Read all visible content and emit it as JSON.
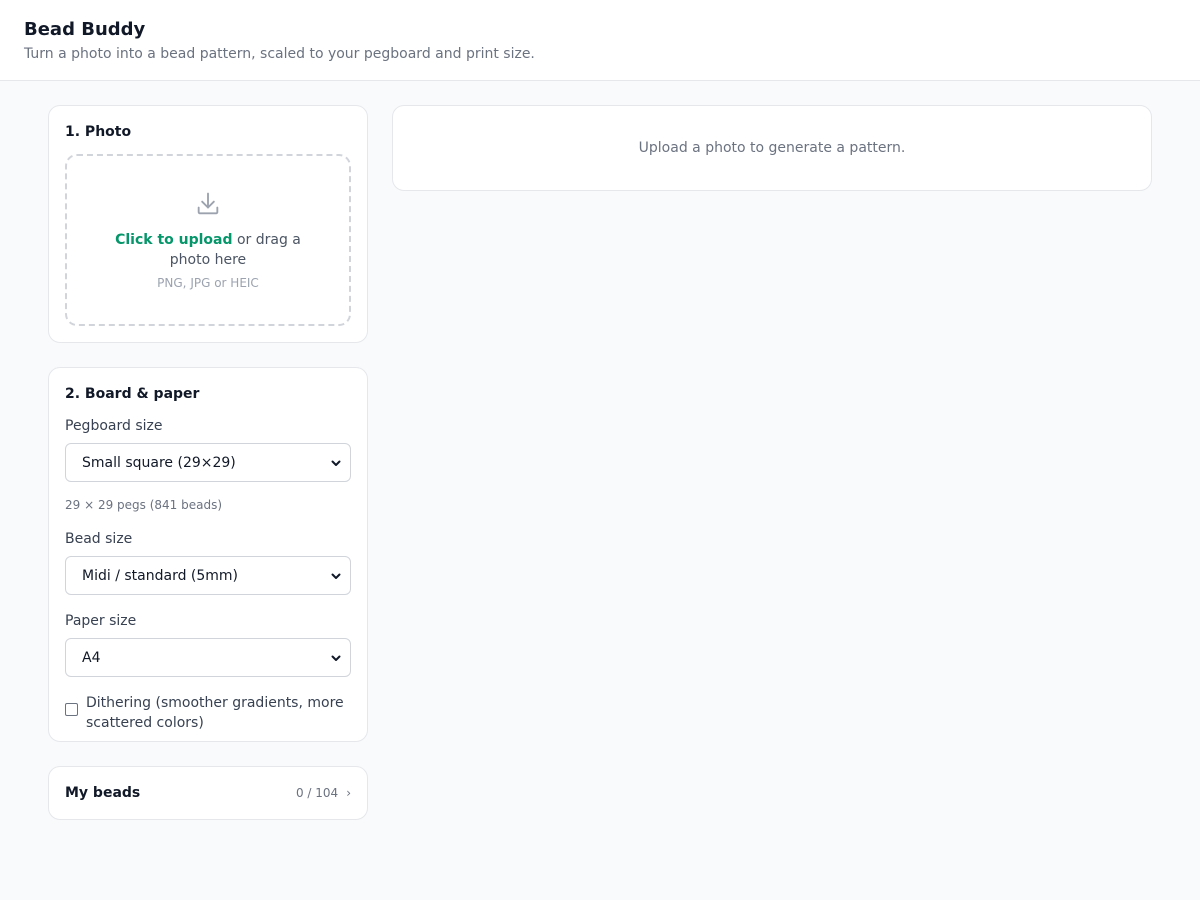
{
  "app": {
    "title": "Bead Buddy",
    "subtitle": "Turn a photo into a bead pattern, scaled to your pegboard and print size."
  },
  "photo": {
    "title": "1. Photo",
    "upload_link": "Click to upload",
    "upload_rest": " or drag a photo here",
    "formats": "PNG, JPG or HEIC",
    "icon": "download-icon"
  },
  "board": {
    "title": "2. Board & paper",
    "pegboard_label": "Pegboard size",
    "pegboard_value": "Small square (29×29)",
    "pegboard_helper": "29 × 29 pegs (841 beads)",
    "bead_label": "Bead size",
    "bead_value": "Midi / standard (5mm)",
    "paper_label": "Paper size",
    "paper_value": "A4",
    "dithering_label": "Dithering (smoother gradients, more scattered colors)",
    "dithering_checked": false
  },
  "beads": {
    "title": "My beads",
    "count": "0 / 104",
    "chevron": "›"
  },
  "preview": {
    "empty_text": "Upload a photo to generate a pattern."
  },
  "colors": {
    "accent": "#059669",
    "border": "#e5e7eb",
    "background": "#f9fafb"
  }
}
